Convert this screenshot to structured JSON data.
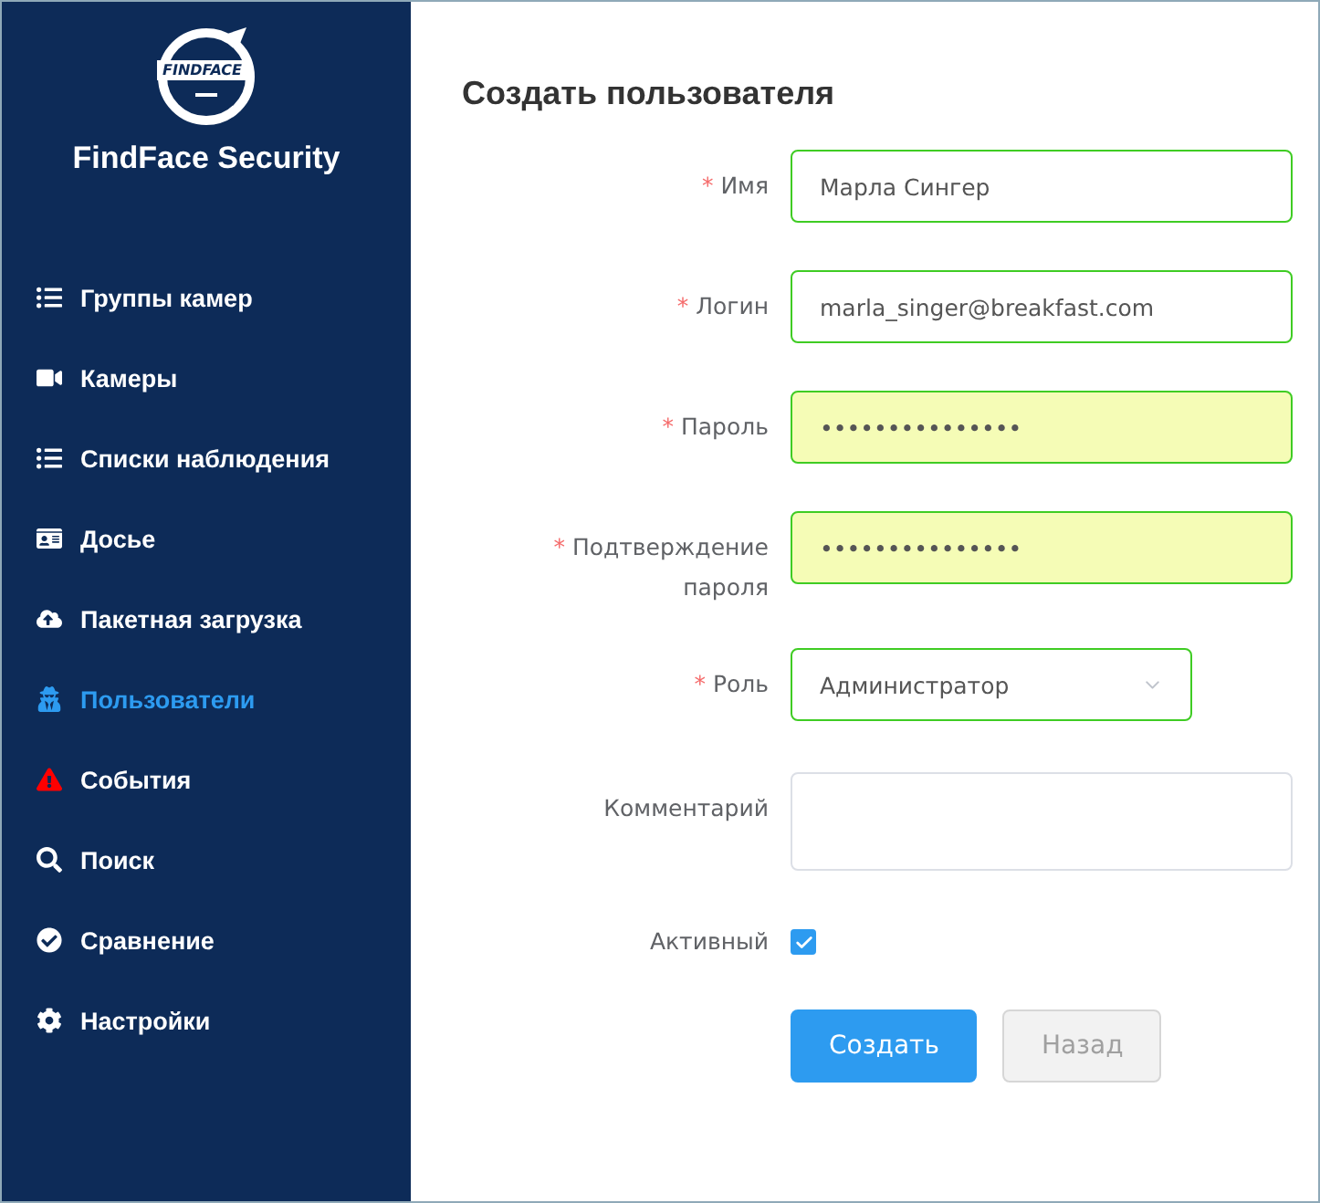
{
  "sidebar": {
    "logo_text": "FINDFACE",
    "app_name": "FindFace Security",
    "items": [
      {
        "label": "Группы камер",
        "selected": false
      },
      {
        "label": "Камеры",
        "selected": false
      },
      {
        "label": "Списки наблюдения",
        "selected": false
      },
      {
        "label": "Досье",
        "selected": false
      },
      {
        "label": "Пакетная загрузка",
        "selected": false
      },
      {
        "label": "Пользователи",
        "selected": true
      },
      {
        "label": "События",
        "selected": false
      },
      {
        "label": "Поиск",
        "selected": false
      },
      {
        "label": "Сравнение",
        "selected": false
      },
      {
        "label": "Настройки",
        "selected": false
      }
    ]
  },
  "form": {
    "title": "Создать пользователя",
    "fields": [
      {
        "kind": "text",
        "required_mark": "*",
        "label": "Имя",
        "value": "Марла Сингер",
        "valid": true,
        "autofilled": false
      },
      {
        "kind": "text",
        "required_mark": "*",
        "label": "Логин",
        "value": "marla_singer@breakfast.com",
        "valid": true,
        "autofilled": false
      },
      {
        "kind": "text",
        "required_mark": "*",
        "label": "Пароль",
        "value": "•••••••••••••••",
        "valid": true,
        "autofilled": true
      },
      {
        "kind": "text",
        "required_mark": "*",
        "label": "Подтверждение пароля",
        "value": "•••••••••••••••",
        "valid": true,
        "autofilled": true
      },
      {
        "kind": "select",
        "required_mark": "*",
        "label": "Роль",
        "value": "Администратор",
        "valid": true
      },
      {
        "kind": "textarea",
        "label": "Комментарий",
        "valid": false
      },
      {
        "kind": "checkbox",
        "label": "Активный",
        "checked": true
      }
    ],
    "buttons": [
      {
        "label": "Создать",
        "primary": true,
        "disabled": false
      },
      {
        "label": "Назад",
        "primary": false,
        "disabled": true
      }
    ]
  }
}
